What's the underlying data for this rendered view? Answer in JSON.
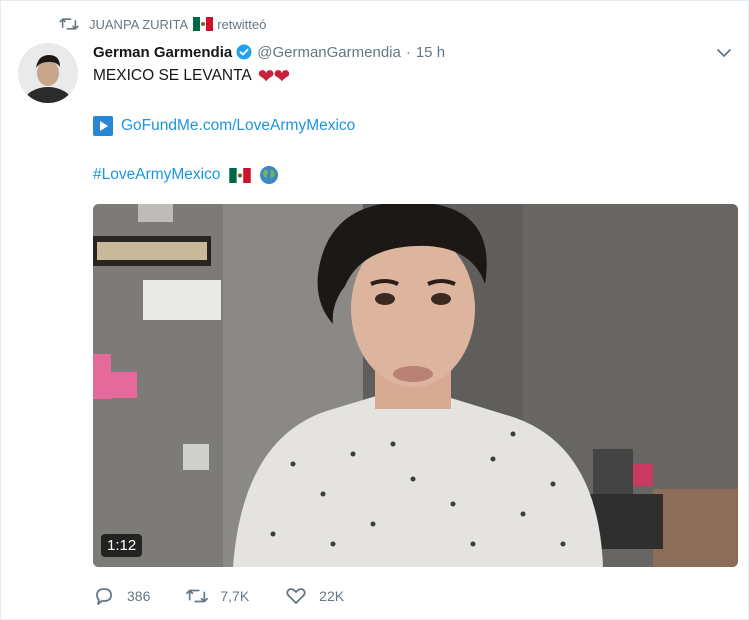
{
  "retweet": {
    "user": "JUANPA ZURITA",
    "action": "retwitteó"
  },
  "tweet": {
    "author_name": "German Garmendia",
    "handle": "@GermanGarmendia",
    "separator": "·",
    "time": "15 h",
    "text": "MEXICO SE LEVANTA",
    "hearts": "❤❤",
    "link": "GoFundMe.com/LoveArmyMexico",
    "hashtag": "#LoveArmyMexico"
  },
  "video": {
    "duration": "1:12"
  },
  "actions": {
    "replies": "386",
    "retweets": "7,7K",
    "likes": "22K"
  },
  "colors": {
    "link": "#1b95e0",
    "muted": "#657786",
    "verified": "#1da1f2",
    "heart": "#c81f3b"
  },
  "icons": [
    "retweet-icon",
    "mexico-flag-icon",
    "verified-badge-icon",
    "chevron-down-icon",
    "play-box-icon",
    "globe-icon",
    "reply-icon",
    "like-icon"
  ]
}
